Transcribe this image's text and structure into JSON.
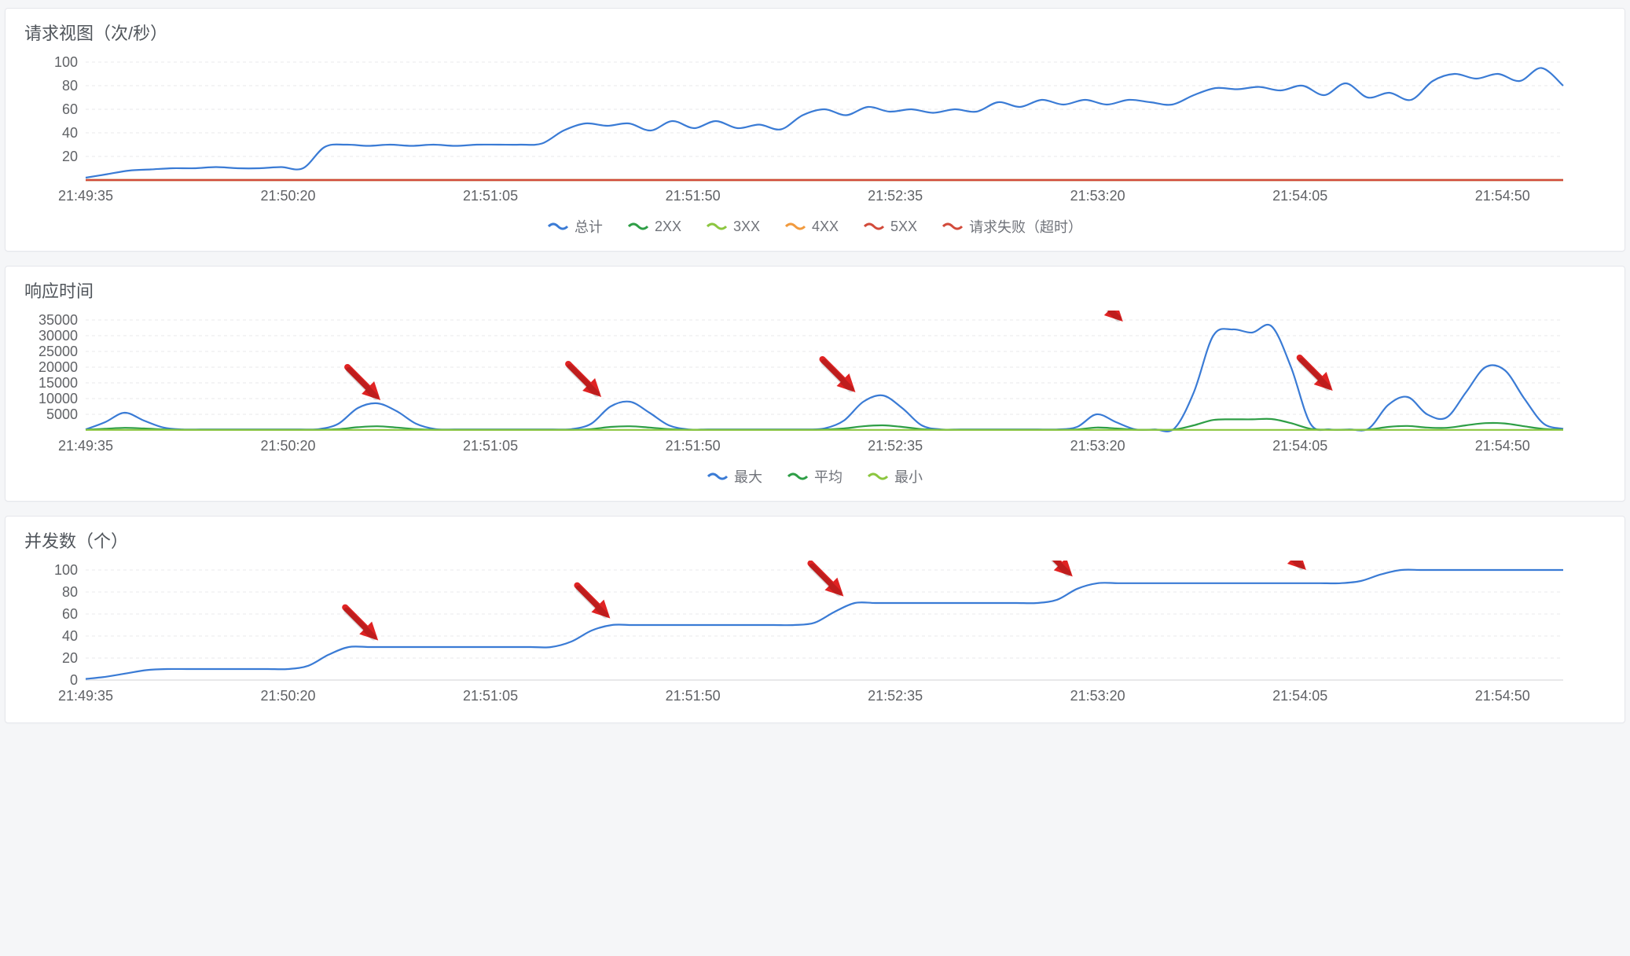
{
  "colors": {
    "blue": "#3a7bd5",
    "green": "#2e9e46",
    "lime": "#8cc63f",
    "orange": "#f19a3e",
    "red": "#d24a3a",
    "arrow": "#e02323"
  },
  "x_categories": [
    "21:49:35",
    "21:50:20",
    "21:51:05",
    "21:51:50",
    "21:52:35",
    "21:53:20",
    "21:54:05",
    "21:54:50"
  ],
  "chart_data": [
    {
      "id": "requests",
      "type": "line",
      "title": "请求视图（次/秒）",
      "xlabel": "",
      "ylabel": "",
      "ylim": [
        0,
        100
      ],
      "yticks": [
        20,
        40,
        60,
        80,
        100
      ],
      "categories_ref": "x_categories",
      "series": [
        {
          "name": "总计",
          "color": "blue",
          "values": [
            2,
            5,
            8,
            9,
            10,
            10,
            11,
            10,
            10,
            11,
            10,
            28,
            30,
            29,
            30,
            29,
            30,
            29,
            30,
            30,
            30,
            31,
            42,
            48,
            46,
            48,
            42,
            50,
            44,
            50,
            44,
            47,
            43,
            55,
            60,
            55,
            62,
            58,
            60,
            57,
            60,
            58,
            66,
            62,
            68,
            64,
            68,
            64,
            68,
            66,
            64,
            72,
            78,
            77,
            79,
            76,
            80,
            72,
            82,
            70,
            74,
            68,
            84,
            90,
            86,
            90,
            84,
            95,
            80
          ]
        },
        {
          "name": "2XX",
          "color": "green",
          "values_const": 0
        },
        {
          "name": "3XX",
          "color": "lime",
          "values_const": 0
        },
        {
          "name": "4XX",
          "color": "orange",
          "values_const": 0
        },
        {
          "name": "5XX",
          "color": "red",
          "values_const": 0
        },
        {
          "name": "请求失败（超时）",
          "color": "red",
          "values_const": 0
        }
      ],
      "legend": [
        "总计",
        "2XX",
        "3XX",
        "4XX",
        "5XX",
        "请求失败（超时）"
      ]
    },
    {
      "id": "response",
      "type": "line",
      "title": "响应时间",
      "xlabel": "",
      "ylabel": "",
      "ylim": [
        0,
        35000
      ],
      "yticks": [
        5000,
        10000,
        15000,
        20000,
        25000,
        30000,
        35000
      ],
      "categories_ref": "x_categories",
      "series": [
        {
          "name": "最大",
          "color": "blue",
          "values": [
            200,
            2500,
            5500,
            3000,
            800,
            200,
            200,
            200,
            200,
            200,
            200,
            200,
            300,
            2000,
            7000,
            8500,
            6000,
            2000,
            300,
            200,
            200,
            200,
            200,
            200,
            200,
            300,
            2000,
            7500,
            9000,
            5500,
            1500,
            200,
            200,
            200,
            200,
            200,
            200,
            200,
            500,
            3000,
            9000,
            11000,
            7000,
            1500,
            200,
            200,
            200,
            200,
            200,
            200,
            200,
            1000,
            5000,
            2500,
            200,
            200,
            500,
            12000,
            30000,
            32000,
            31000,
            33000,
            20000,
            2000,
            200,
            200,
            500,
            8000,
            10500,
            5000,
            4000,
            12000,
            20000,
            19000,
            10000,
            2000,
            400
          ]
        },
        {
          "name": "平均",
          "color": "green",
          "values": [
            100,
            400,
            700,
            500,
            200,
            100,
            100,
            100,
            100,
            100,
            100,
            100,
            100,
            300,
            900,
            1200,
            800,
            300,
            100,
            100,
            100,
            100,
            100,
            100,
            100,
            100,
            300,
            1000,
            1200,
            800,
            300,
            100,
            100,
            100,
            100,
            100,
            100,
            100,
            150,
            500,
            1200,
            1500,
            1000,
            300,
            100,
            100,
            100,
            100,
            100,
            100,
            100,
            200,
            800,
            500,
            100,
            100,
            150,
            1500,
            3200,
            3400,
            3400,
            3500,
            2200,
            400,
            100,
            100,
            150,
            1000,
            1300,
            800,
            700,
            1500,
            2200,
            2100,
            1200,
            350,
            120
          ]
        },
        {
          "name": "最小",
          "color": "lime",
          "values_const": 50
        }
      ],
      "legend": [
        "最大",
        "平均",
        "最小"
      ],
      "annotations": [
        {
          "type": "arrow",
          "x_frac": 0.1995,
          "y_val": 9500
        },
        {
          "type": "arrow",
          "x_frac": 0.349,
          "y_val": 10500
        },
        {
          "type": "arrow",
          "x_frac": 0.521,
          "y_val": 12000
        },
        {
          "type": "arrow",
          "x_frac": 0.702,
          "y_val": 34500
        },
        {
          "type": "arrow",
          "x_frac": 0.844,
          "y_val": 12500
        }
      ]
    },
    {
      "id": "concurrency",
      "type": "line",
      "title": "并发数（个）",
      "xlabel": "",
      "ylabel": "",
      "ylim": [
        0,
        100
      ],
      "yticks": [
        0,
        20,
        40,
        60,
        80,
        100
      ],
      "categories_ref": "x_categories",
      "series": [
        {
          "name": "并发",
          "color": "blue",
          "values": [
            1,
            3,
            6,
            9,
            10,
            10,
            10,
            10,
            10,
            10,
            10,
            13,
            23,
            30,
            30,
            30,
            30,
            30,
            30,
            30,
            30,
            30,
            30,
            30,
            35,
            45,
            50,
            50,
            50,
            50,
            50,
            50,
            50,
            50,
            50,
            50,
            52,
            62,
            70,
            70,
            70,
            70,
            70,
            70,
            70,
            70,
            70,
            70,
            73,
            83,
            88,
            88,
            88,
            88,
            88,
            88,
            88,
            88,
            88,
            88,
            88,
            88,
            88,
            90,
            96,
            100,
            100,
            100,
            100,
            100,
            100,
            100,
            100,
            100
          ]
        }
      ],
      "legend": [],
      "annotations": [
        {
          "type": "arrow",
          "x_frac": 0.198,
          "y_val": 36
        },
        {
          "type": "arrow",
          "x_frac": 0.355,
          "y_val": 56
        },
        {
          "type": "arrow",
          "x_frac": 0.513,
          "y_val": 76
        },
        {
          "type": "arrow",
          "x_frac": 0.668,
          "y_val": 94
        },
        {
          "type": "arrow",
          "x_frac": 0.826,
          "y_val": 105
        }
      ]
    }
  ]
}
